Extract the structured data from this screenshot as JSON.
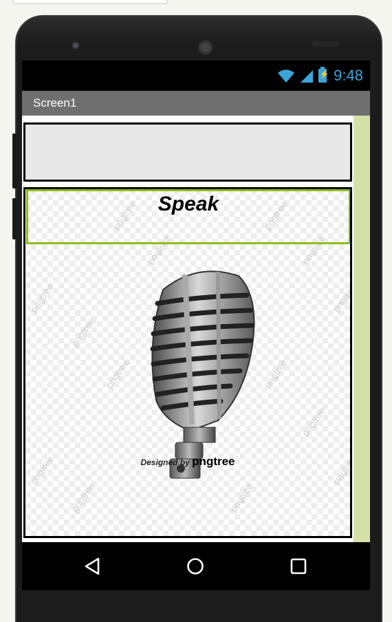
{
  "status_bar": {
    "time": "9:48",
    "icons": [
      "wifi-icon",
      "signal-icon",
      "battery-icon"
    ]
  },
  "app": {
    "title": "Screen1"
  },
  "main": {
    "speak_button_label": "Speak",
    "image_credit_prefix": "Designed by",
    "image_credit_brand": "pngtree",
    "watermark_text": "pngtree"
  },
  "nav_bar": {
    "buttons": [
      "back-icon",
      "home-icon",
      "recents-icon"
    ]
  },
  "colors": {
    "status_accent": "#3aa6d8",
    "titlebar": "#6f6f6f",
    "speak_border": "#8cbe1e",
    "scroll_strip": "#d4e0a8"
  }
}
